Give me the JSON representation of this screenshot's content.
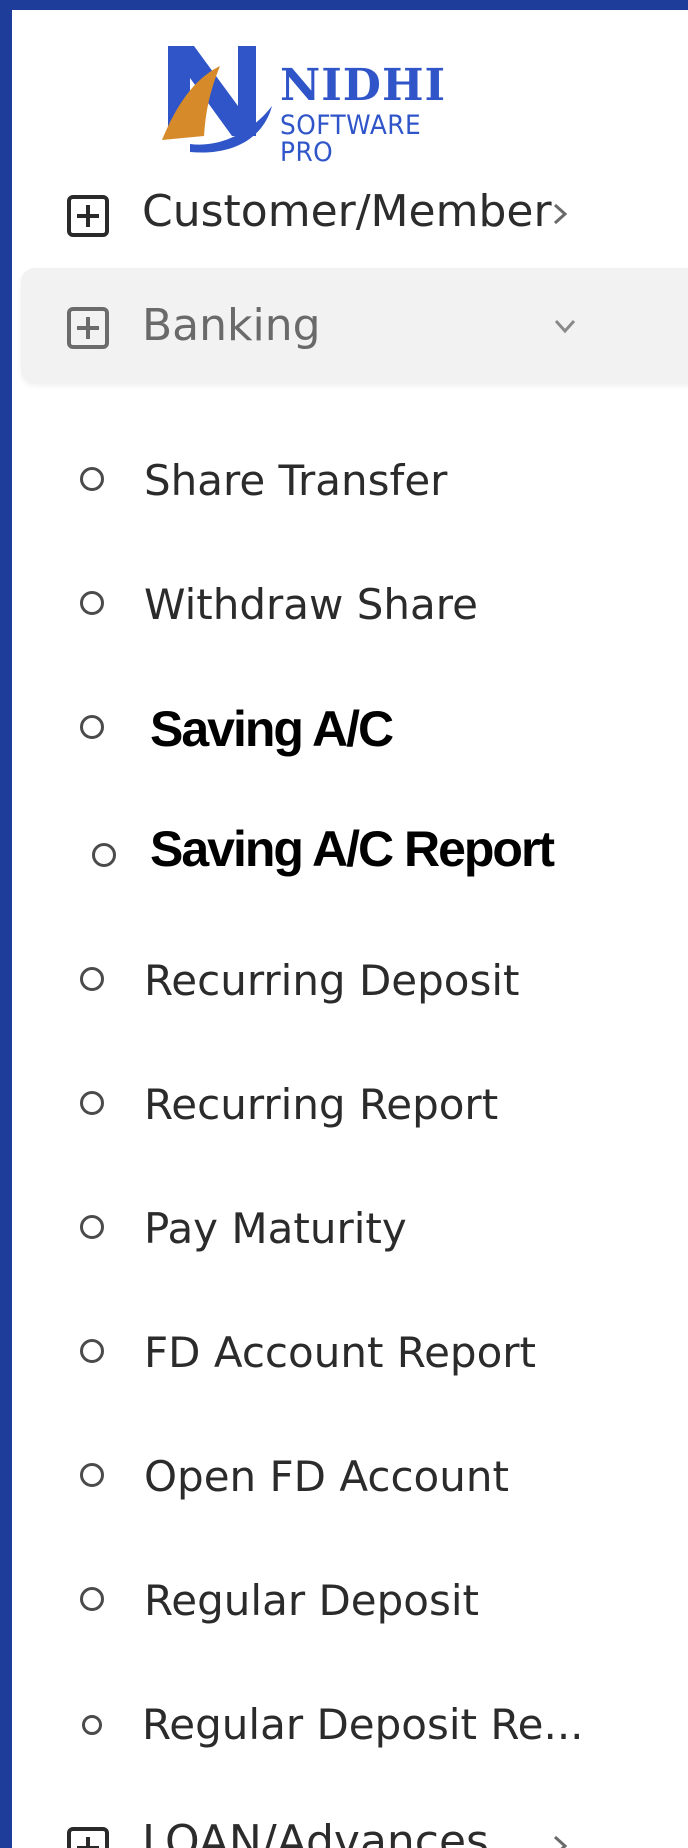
{
  "brand": {
    "title": "NIDHI",
    "subtitle": "SOFTWARE PRO",
    "colors": {
      "blue": "#2f55c9",
      "orange": "#d68a2a",
      "frame": "#1e3d9a"
    }
  },
  "menu": {
    "customer": {
      "label": "Customer/Member",
      "icon": "plus-square-icon",
      "chevron": "chevron-right-icon"
    },
    "banking": {
      "label": "Banking",
      "icon": "plus-square-icon",
      "chevron": "chevron-down-icon",
      "expanded": true
    },
    "banking_items": [
      {
        "label": "Share Transfer"
      },
      {
        "label": "Withdraw Share"
      },
      {
        "label": "Saving A/C"
      },
      {
        "label": "Saving A/C Report"
      },
      {
        "label": "Recurring Deposit"
      },
      {
        "label": "Recurring Report"
      },
      {
        "label": "Pay Maturity"
      },
      {
        "label": "FD Account Report"
      },
      {
        "label": "Open FD Account"
      },
      {
        "label": "Regular Deposit"
      },
      {
        "label": "Regular Deposit Re..."
      }
    ],
    "loan": {
      "label": "LOAN/Advances",
      "icon": "plus-square-icon",
      "chevron": "chevron-right-icon"
    }
  }
}
